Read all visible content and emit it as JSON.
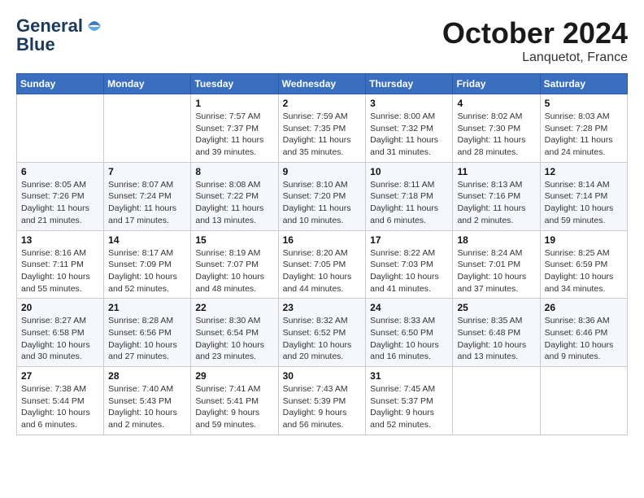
{
  "header": {
    "logo_line1": "General",
    "logo_line2": "Blue",
    "month_title": "October 2024",
    "location": "Lanquetot, France"
  },
  "weekdays": [
    "Sunday",
    "Monday",
    "Tuesday",
    "Wednesday",
    "Thursday",
    "Friday",
    "Saturday"
  ],
  "weeks": [
    [
      {
        "day": "",
        "info": ""
      },
      {
        "day": "",
        "info": ""
      },
      {
        "day": "1",
        "info": "Sunrise: 7:57 AM\nSunset: 7:37 PM\nDaylight: 11 hours and 39 minutes."
      },
      {
        "day": "2",
        "info": "Sunrise: 7:59 AM\nSunset: 7:35 PM\nDaylight: 11 hours and 35 minutes."
      },
      {
        "day": "3",
        "info": "Sunrise: 8:00 AM\nSunset: 7:32 PM\nDaylight: 11 hours and 31 minutes."
      },
      {
        "day": "4",
        "info": "Sunrise: 8:02 AM\nSunset: 7:30 PM\nDaylight: 11 hours and 28 minutes."
      },
      {
        "day": "5",
        "info": "Sunrise: 8:03 AM\nSunset: 7:28 PM\nDaylight: 11 hours and 24 minutes."
      }
    ],
    [
      {
        "day": "6",
        "info": "Sunrise: 8:05 AM\nSunset: 7:26 PM\nDaylight: 11 hours and 21 minutes."
      },
      {
        "day": "7",
        "info": "Sunrise: 8:07 AM\nSunset: 7:24 PM\nDaylight: 11 hours and 17 minutes."
      },
      {
        "day": "8",
        "info": "Sunrise: 8:08 AM\nSunset: 7:22 PM\nDaylight: 11 hours and 13 minutes."
      },
      {
        "day": "9",
        "info": "Sunrise: 8:10 AM\nSunset: 7:20 PM\nDaylight: 11 hours and 10 minutes."
      },
      {
        "day": "10",
        "info": "Sunrise: 8:11 AM\nSunset: 7:18 PM\nDaylight: 11 hours and 6 minutes."
      },
      {
        "day": "11",
        "info": "Sunrise: 8:13 AM\nSunset: 7:16 PM\nDaylight: 11 hours and 2 minutes."
      },
      {
        "day": "12",
        "info": "Sunrise: 8:14 AM\nSunset: 7:14 PM\nDaylight: 10 hours and 59 minutes."
      }
    ],
    [
      {
        "day": "13",
        "info": "Sunrise: 8:16 AM\nSunset: 7:11 PM\nDaylight: 10 hours and 55 minutes."
      },
      {
        "day": "14",
        "info": "Sunrise: 8:17 AM\nSunset: 7:09 PM\nDaylight: 10 hours and 52 minutes."
      },
      {
        "day": "15",
        "info": "Sunrise: 8:19 AM\nSunset: 7:07 PM\nDaylight: 10 hours and 48 minutes."
      },
      {
        "day": "16",
        "info": "Sunrise: 8:20 AM\nSunset: 7:05 PM\nDaylight: 10 hours and 44 minutes."
      },
      {
        "day": "17",
        "info": "Sunrise: 8:22 AM\nSunset: 7:03 PM\nDaylight: 10 hours and 41 minutes."
      },
      {
        "day": "18",
        "info": "Sunrise: 8:24 AM\nSunset: 7:01 PM\nDaylight: 10 hours and 37 minutes."
      },
      {
        "day": "19",
        "info": "Sunrise: 8:25 AM\nSunset: 6:59 PM\nDaylight: 10 hours and 34 minutes."
      }
    ],
    [
      {
        "day": "20",
        "info": "Sunrise: 8:27 AM\nSunset: 6:58 PM\nDaylight: 10 hours and 30 minutes."
      },
      {
        "day": "21",
        "info": "Sunrise: 8:28 AM\nSunset: 6:56 PM\nDaylight: 10 hours and 27 minutes."
      },
      {
        "day": "22",
        "info": "Sunrise: 8:30 AM\nSunset: 6:54 PM\nDaylight: 10 hours and 23 minutes."
      },
      {
        "day": "23",
        "info": "Sunrise: 8:32 AM\nSunset: 6:52 PM\nDaylight: 10 hours and 20 minutes."
      },
      {
        "day": "24",
        "info": "Sunrise: 8:33 AM\nSunset: 6:50 PM\nDaylight: 10 hours and 16 minutes."
      },
      {
        "day": "25",
        "info": "Sunrise: 8:35 AM\nSunset: 6:48 PM\nDaylight: 10 hours and 13 minutes."
      },
      {
        "day": "26",
        "info": "Sunrise: 8:36 AM\nSunset: 6:46 PM\nDaylight: 10 hours and 9 minutes."
      }
    ],
    [
      {
        "day": "27",
        "info": "Sunrise: 7:38 AM\nSunset: 5:44 PM\nDaylight: 10 hours and 6 minutes."
      },
      {
        "day": "28",
        "info": "Sunrise: 7:40 AM\nSunset: 5:43 PM\nDaylight: 10 hours and 2 minutes."
      },
      {
        "day": "29",
        "info": "Sunrise: 7:41 AM\nSunset: 5:41 PM\nDaylight: 9 hours and 59 minutes."
      },
      {
        "day": "30",
        "info": "Sunrise: 7:43 AM\nSunset: 5:39 PM\nDaylight: 9 hours and 56 minutes."
      },
      {
        "day": "31",
        "info": "Sunrise: 7:45 AM\nSunset: 5:37 PM\nDaylight: 9 hours and 52 minutes."
      },
      {
        "day": "",
        "info": ""
      },
      {
        "day": "",
        "info": ""
      }
    ]
  ]
}
